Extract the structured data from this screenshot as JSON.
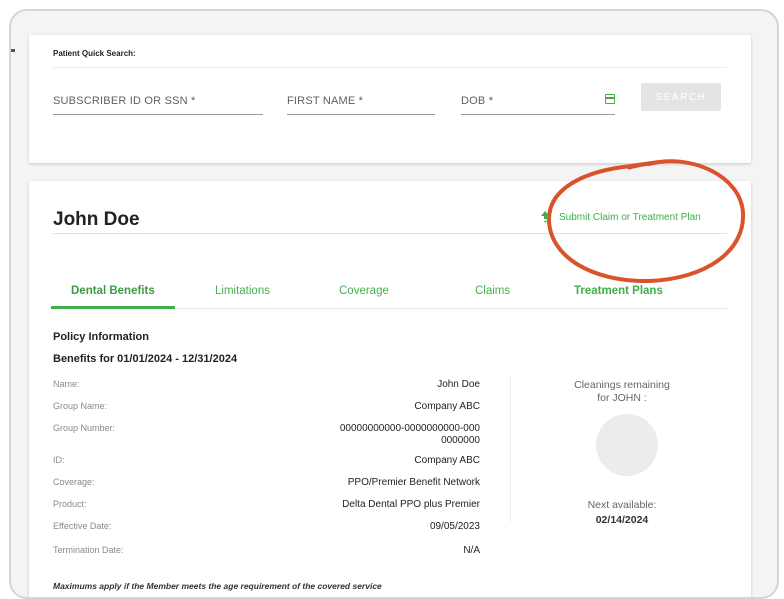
{
  "search": {
    "title": "Patient Quick Search:",
    "subscriber_label": "SUBSCRIBER ID OR SSN *",
    "first_name_label": "FIRST NAME *",
    "dob_label": "DOB *",
    "button_label": "SEARCH"
  },
  "patient": {
    "name": "John Doe",
    "submit_link": "Submit Claim or Treatment Plan"
  },
  "tabs": [
    "Dental Benefits",
    "Limitations",
    "Coverage",
    "Claims",
    "Treatment Plans"
  ],
  "policy": {
    "title": "Policy Information",
    "benefits_period": "Benefits for 01/01/2024 - 12/31/2024",
    "rows": [
      {
        "label": "Name:",
        "value": "John Doe"
      },
      {
        "label": "Group Name:",
        "value": "Company ABC"
      },
      {
        "label": "Group Number:",
        "value": "00000000000-0000000000-000",
        "value2": "0000000"
      },
      {
        "label": "ID:",
        "value": "Company ABC"
      },
      {
        "label": "Coverage:",
        "value": "PPO/Premier Benefit Network"
      },
      {
        "label": "Product:",
        "value": "Delta Dental PPO plus Premier"
      },
      {
        "label": "Effective Date:",
        "value": "09/05/2023"
      },
      {
        "label": "Termination Date:",
        "value": "N/A"
      }
    ],
    "footnote": "Maximums apply if the Member meets the age requirement of the covered service"
  },
  "cleanings": {
    "label_line1": "Cleanings remaining",
    "label_line2": "for JOHN :",
    "next_available_label": "Next available:",
    "next_available_date": "02/14/2024"
  },
  "colors": {
    "accent_green": "#3fae48",
    "annotation_orange": "#d9532c"
  }
}
